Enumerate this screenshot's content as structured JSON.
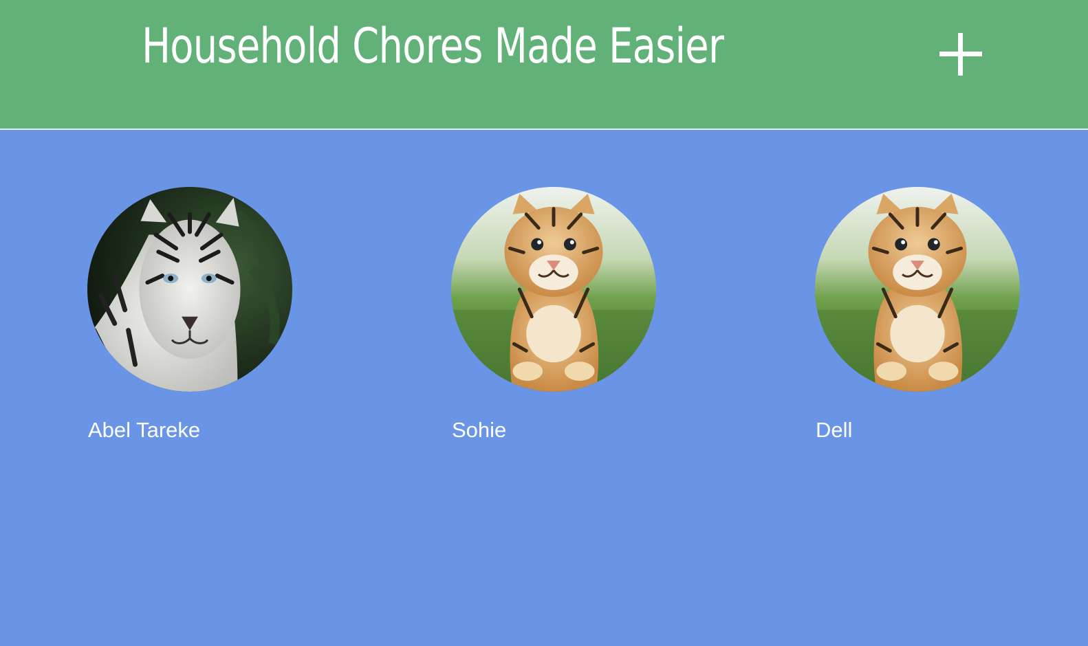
{
  "header": {
    "title": "Household Chores Made Easier",
    "add_icon": "plus-icon"
  },
  "colors": {
    "header_bg": "#61b178",
    "page_bg": "#6a95e6",
    "text": "#ffffff"
  },
  "members": [
    {
      "name": "Abel Tareke",
      "avatar": "white-tiger-photo"
    },
    {
      "name": "Sohie",
      "avatar": "tiger-cub-photo"
    },
    {
      "name": "Dell",
      "avatar": "tiger-cub-photo"
    }
  ]
}
